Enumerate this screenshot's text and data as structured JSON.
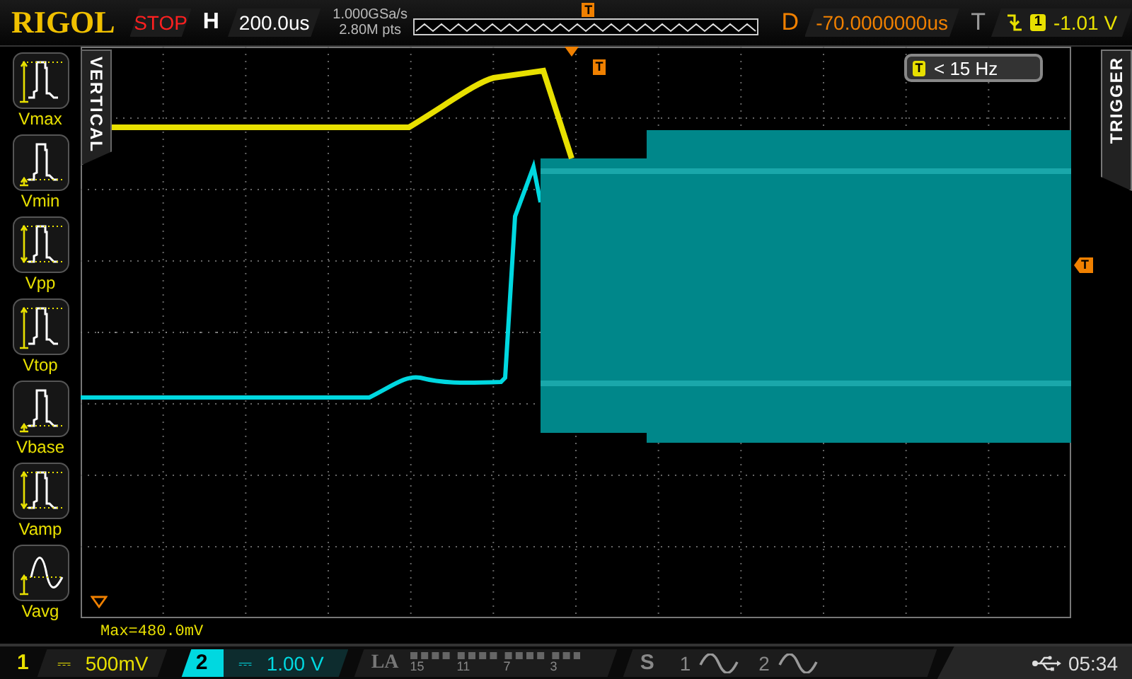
{
  "header": {
    "logo": "RIGOL",
    "run_state": "STOP",
    "running": false,
    "horizontal_label": "H",
    "timebase": "200.0us",
    "sample_rate": "1.000GSa/s",
    "memory_depth": "2.80M pts",
    "overview_marker": "T",
    "delay_label": "D",
    "delay": "-70.0000000us",
    "trigger_label": "T",
    "trigger_source": "1",
    "trigger_level": "-1.01 V"
  },
  "vertical_tab": "VERTICAL",
  "measurements": [
    {
      "label": "Vmax",
      "kind": "max"
    },
    {
      "label": "Vmin",
      "kind": "min"
    },
    {
      "label": "Vpp",
      "kind": "pp"
    },
    {
      "label": "Vtop",
      "kind": "top"
    },
    {
      "label": "Vbase",
      "kind": "base"
    },
    {
      "label": "Vamp",
      "kind": "amp"
    },
    {
      "label": "Vavg",
      "kind": "avg"
    }
  ],
  "plot": {
    "trigger_position_marker": "T",
    "trigger_level_marker": "T",
    "frequency_counter": {
      "badge": "T",
      "value": "< 15 Hz"
    },
    "readout": "Max=480.0mV"
  },
  "trigger_tab": "TRIGGER",
  "channels": [
    {
      "number": "1",
      "coupling": "⎓",
      "scale": "500mV",
      "selected": false,
      "color": "#e8e000"
    },
    {
      "number": "2",
      "coupling": "⎓",
      "scale": "1.00 V",
      "selected": true,
      "color": "#00d8e0"
    }
  ],
  "logic_analyzer": {
    "label": "LA",
    "channels": [
      "15",
      "11",
      "7",
      "3"
    ]
  },
  "math": {
    "label": "S",
    "sources": [
      "1",
      "2"
    ]
  },
  "status": {
    "time": "05:34"
  }
}
